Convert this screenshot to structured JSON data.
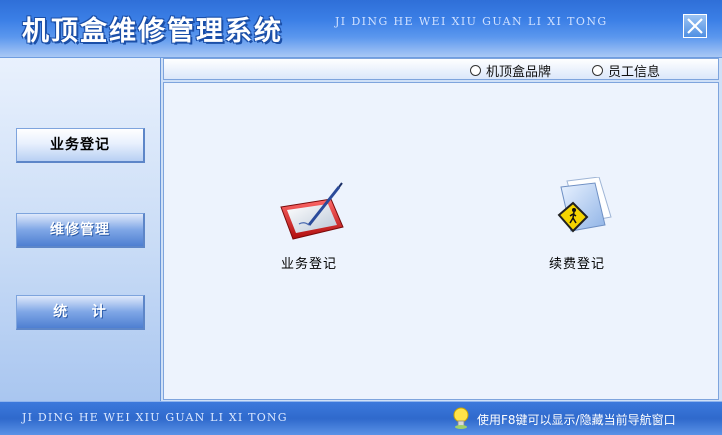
{
  "window": {
    "title": "机顶盒维修管理系统",
    "subtitle": "JI DING HE WEI XIU GUAN LI XI TONG",
    "close_icon": "close-x-icon"
  },
  "sidebar": {
    "items": [
      {
        "label": "业务登记"
      },
      {
        "label": "维修管理"
      },
      {
        "label": "统    计"
      }
    ]
  },
  "tabs": [
    {
      "label": "机顶盒品牌",
      "icon": "radio-icon"
    },
    {
      "label": "员工信息",
      "icon": "radio-icon"
    }
  ],
  "main": {
    "tiles": [
      {
        "label": "业务登记",
        "icon": "tablet-pen-icon"
      },
      {
        "label": "续费登记",
        "icon": "folder-pedestrian-icon"
      }
    ]
  },
  "statusbar": {
    "left_text": "JI DING HE WEI XIU GUAN LI XI TONG",
    "hint": "使用F8键可以显示/隐藏当前导航窗口",
    "hint_icon": "lightbulb-icon"
  },
  "colors": {
    "title_bar": "#3b7fe6",
    "status_bar": "#2f69cc",
    "content_bg": "#edf3fd"
  }
}
